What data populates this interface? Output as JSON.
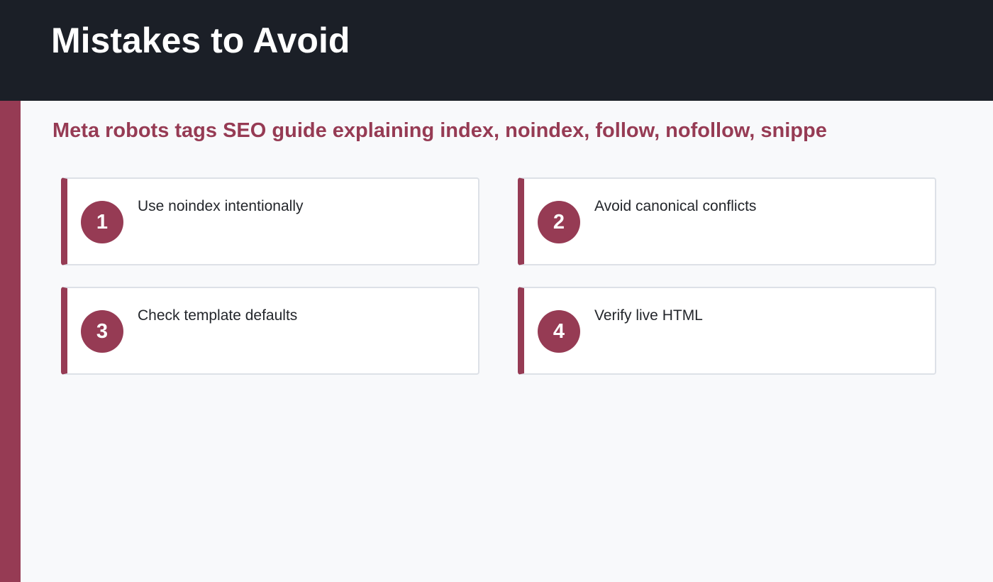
{
  "header": {
    "title": "Mistakes to Avoid"
  },
  "subtitle": "Meta robots tags SEO guide explaining index, noindex, follow, nofollow, snippe",
  "colors": {
    "accent": "#963b54",
    "header_bg": "#1b1f27",
    "page_bg": "#f8f9fb"
  },
  "cards": [
    {
      "number": "1",
      "label": "Use noindex intentionally"
    },
    {
      "number": "2",
      "label": "Avoid canonical conflicts"
    },
    {
      "number": "3",
      "label": "Check template defaults"
    },
    {
      "number": "4",
      "label": "Verify live HTML"
    }
  ]
}
